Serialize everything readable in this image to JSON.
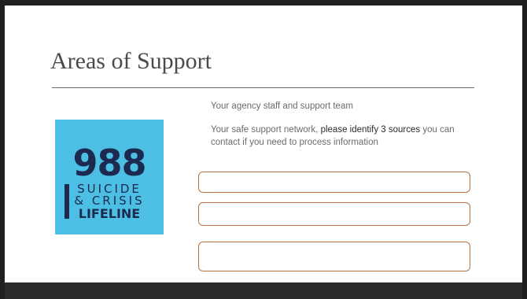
{
  "slide": {
    "title": "Areas of Support",
    "line1": "Your agency staff and support team",
    "para_part1": "Your safe support network, ",
    "para_emph": "please identify 3 sources",
    "para_part2": " you can contact if you need to process information"
  },
  "logo": {
    "number": "988",
    "word1": "SUICIDE",
    "word2": "& CRISIS",
    "word3": "LIFELINE"
  },
  "fields": [
    {
      "value": ""
    },
    {
      "value": ""
    },
    {
      "value": ""
    }
  ],
  "colors": {
    "field_border": "#b87342",
    "logo_background": "#4dbfe5",
    "logo_text": "#1b2a4e"
  }
}
